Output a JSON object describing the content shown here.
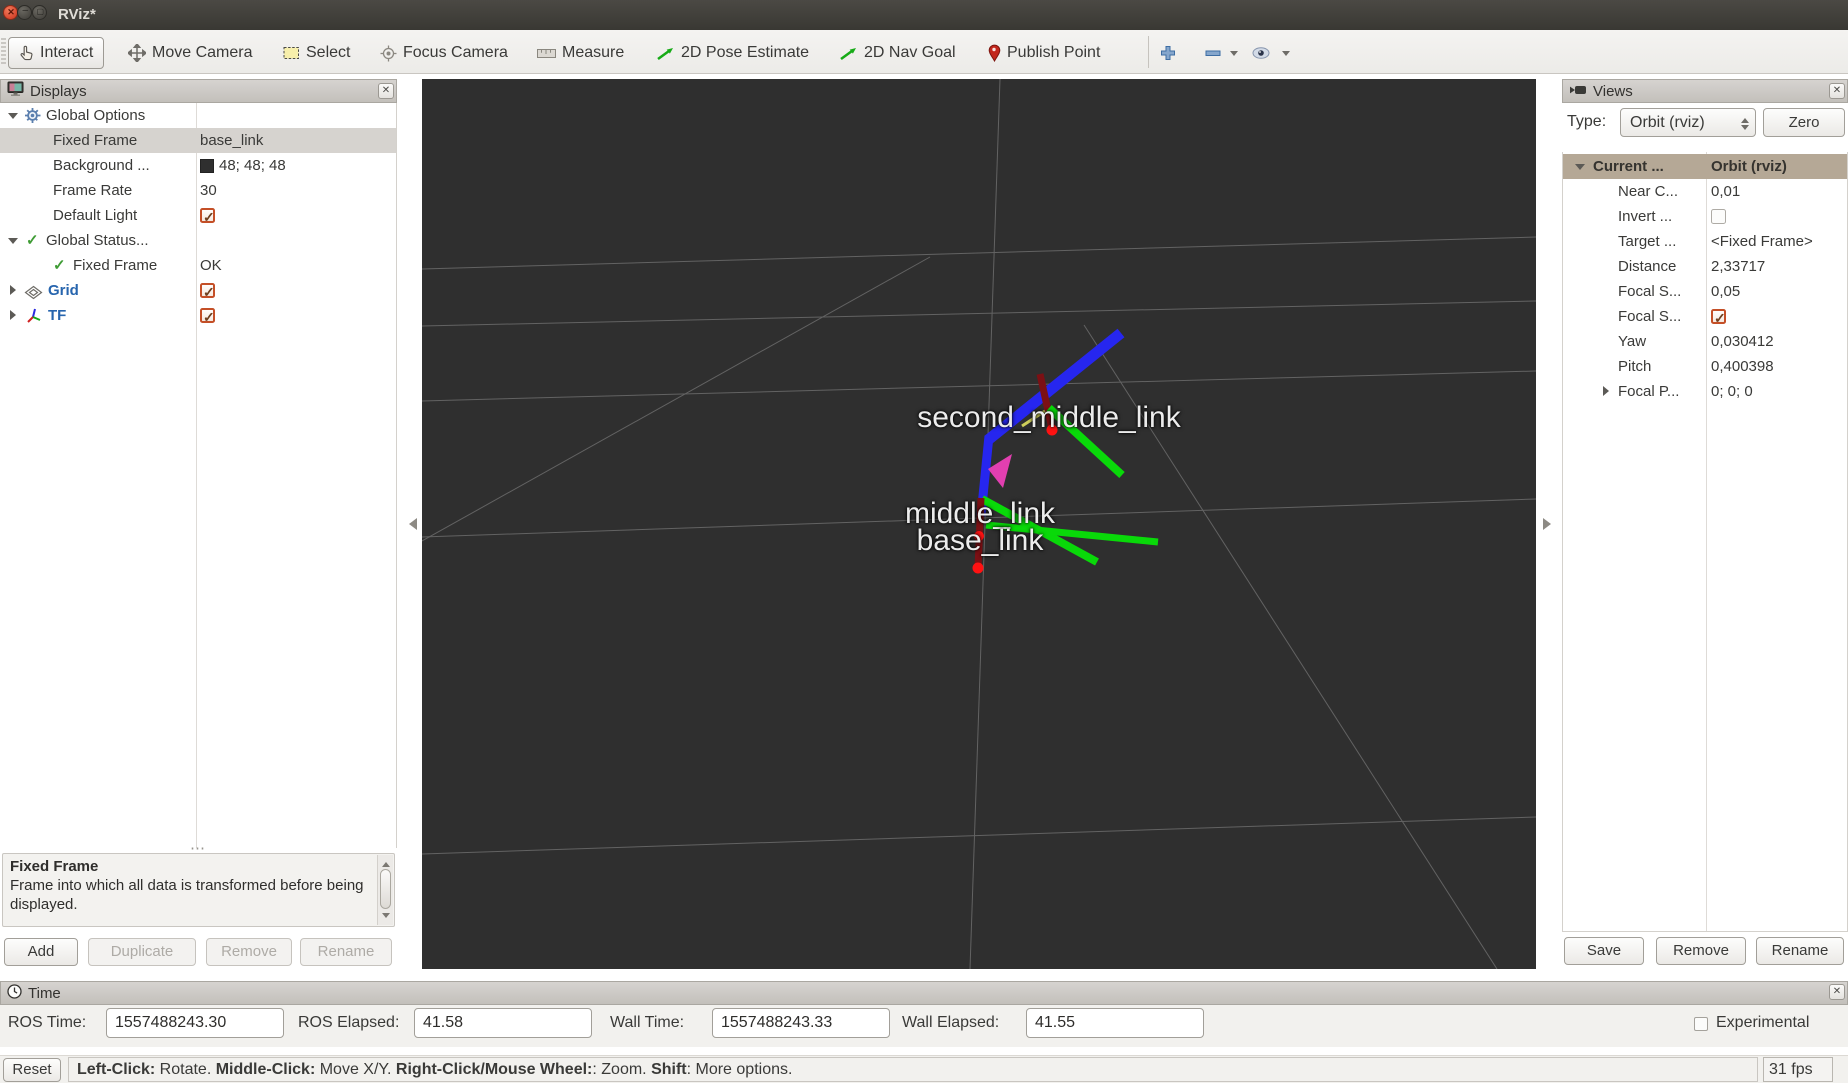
{
  "window": {
    "title": "RViz*"
  },
  "toolbar": {
    "tools": [
      {
        "label": "Interact"
      },
      {
        "label": "Move Camera"
      },
      {
        "label": "Select"
      },
      {
        "label": "Focus Camera"
      },
      {
        "label": "Measure"
      },
      {
        "label": "2D Pose Estimate"
      },
      {
        "label": "2D Nav Goal"
      },
      {
        "label": "Publish Point"
      }
    ]
  },
  "displays": {
    "title": "Displays",
    "rows": [
      {
        "label": "Global Options",
        "value": ""
      },
      {
        "label": "Fixed Frame",
        "value": "base_link"
      },
      {
        "label": "Background ...",
        "value": "48; 48; 48"
      },
      {
        "label": "Frame Rate",
        "value": "30"
      },
      {
        "label": "Default Light",
        "value": ""
      },
      {
        "label": "Global Status...",
        "value": ""
      },
      {
        "label": "Fixed Frame",
        "value": "OK"
      },
      {
        "label": "Grid",
        "value": ""
      },
      {
        "label": "TF",
        "value": ""
      }
    ],
    "help": {
      "title": "Fixed Frame",
      "body": "Frame into which all data is transformed before being displayed."
    },
    "buttons": {
      "add": "Add",
      "duplicate": "Duplicate",
      "remove": "Remove",
      "rename": "Rename"
    }
  },
  "viewport": {
    "background": "#2f2f2f",
    "tf_labels": {
      "second": "second_middle_link",
      "middle": "middle_link",
      "base": "base_link"
    }
  },
  "views": {
    "title": "Views",
    "type_label": "Type:",
    "type_value": "Orbit (rviz)",
    "zero": "Zero",
    "rows": [
      {
        "label": "Current ...",
        "value": "Orbit (rviz)"
      },
      {
        "label": "Near C...",
        "value": "0,01"
      },
      {
        "label": "Invert ...",
        "value": ""
      },
      {
        "label": "Target ...",
        "value": "<Fixed Frame>"
      },
      {
        "label": "Distance",
        "value": "2,33717"
      },
      {
        "label": "Focal S...",
        "value": "0,05"
      },
      {
        "label": "Focal S...",
        "value": ""
      },
      {
        "label": "Yaw",
        "value": "0,030412"
      },
      {
        "label": "Pitch",
        "value": "0,400398"
      },
      {
        "label": "Focal P...",
        "value": "0; 0; 0"
      }
    ],
    "buttons": {
      "save": "Save",
      "remove": "Remove",
      "rename": "Rename"
    }
  },
  "time": {
    "title": "Time",
    "fields": [
      {
        "label": "ROS Time:",
        "value": "1557488243.30"
      },
      {
        "label": "ROS Elapsed:",
        "value": "41.58"
      },
      {
        "label": "Wall Time:",
        "value": "1557488243.33"
      },
      {
        "label": "Wall Elapsed:",
        "value": "41.55"
      }
    ],
    "experimental": "Experimental"
  },
  "status": {
    "reset": "Reset",
    "help": [
      {
        "text": "Left-Click:"
      },
      {
        "text": " Rotate. "
      },
      {
        "text": "Middle-Click:"
      },
      {
        "text": " Move X/Y. "
      },
      {
        "text": "Right-Click/Mouse Wheel:"
      },
      {
        "text": ": Zoom. "
      },
      {
        "text": "Shift"
      },
      {
        "text": ": More options."
      }
    ],
    "fps": "31 fps"
  }
}
